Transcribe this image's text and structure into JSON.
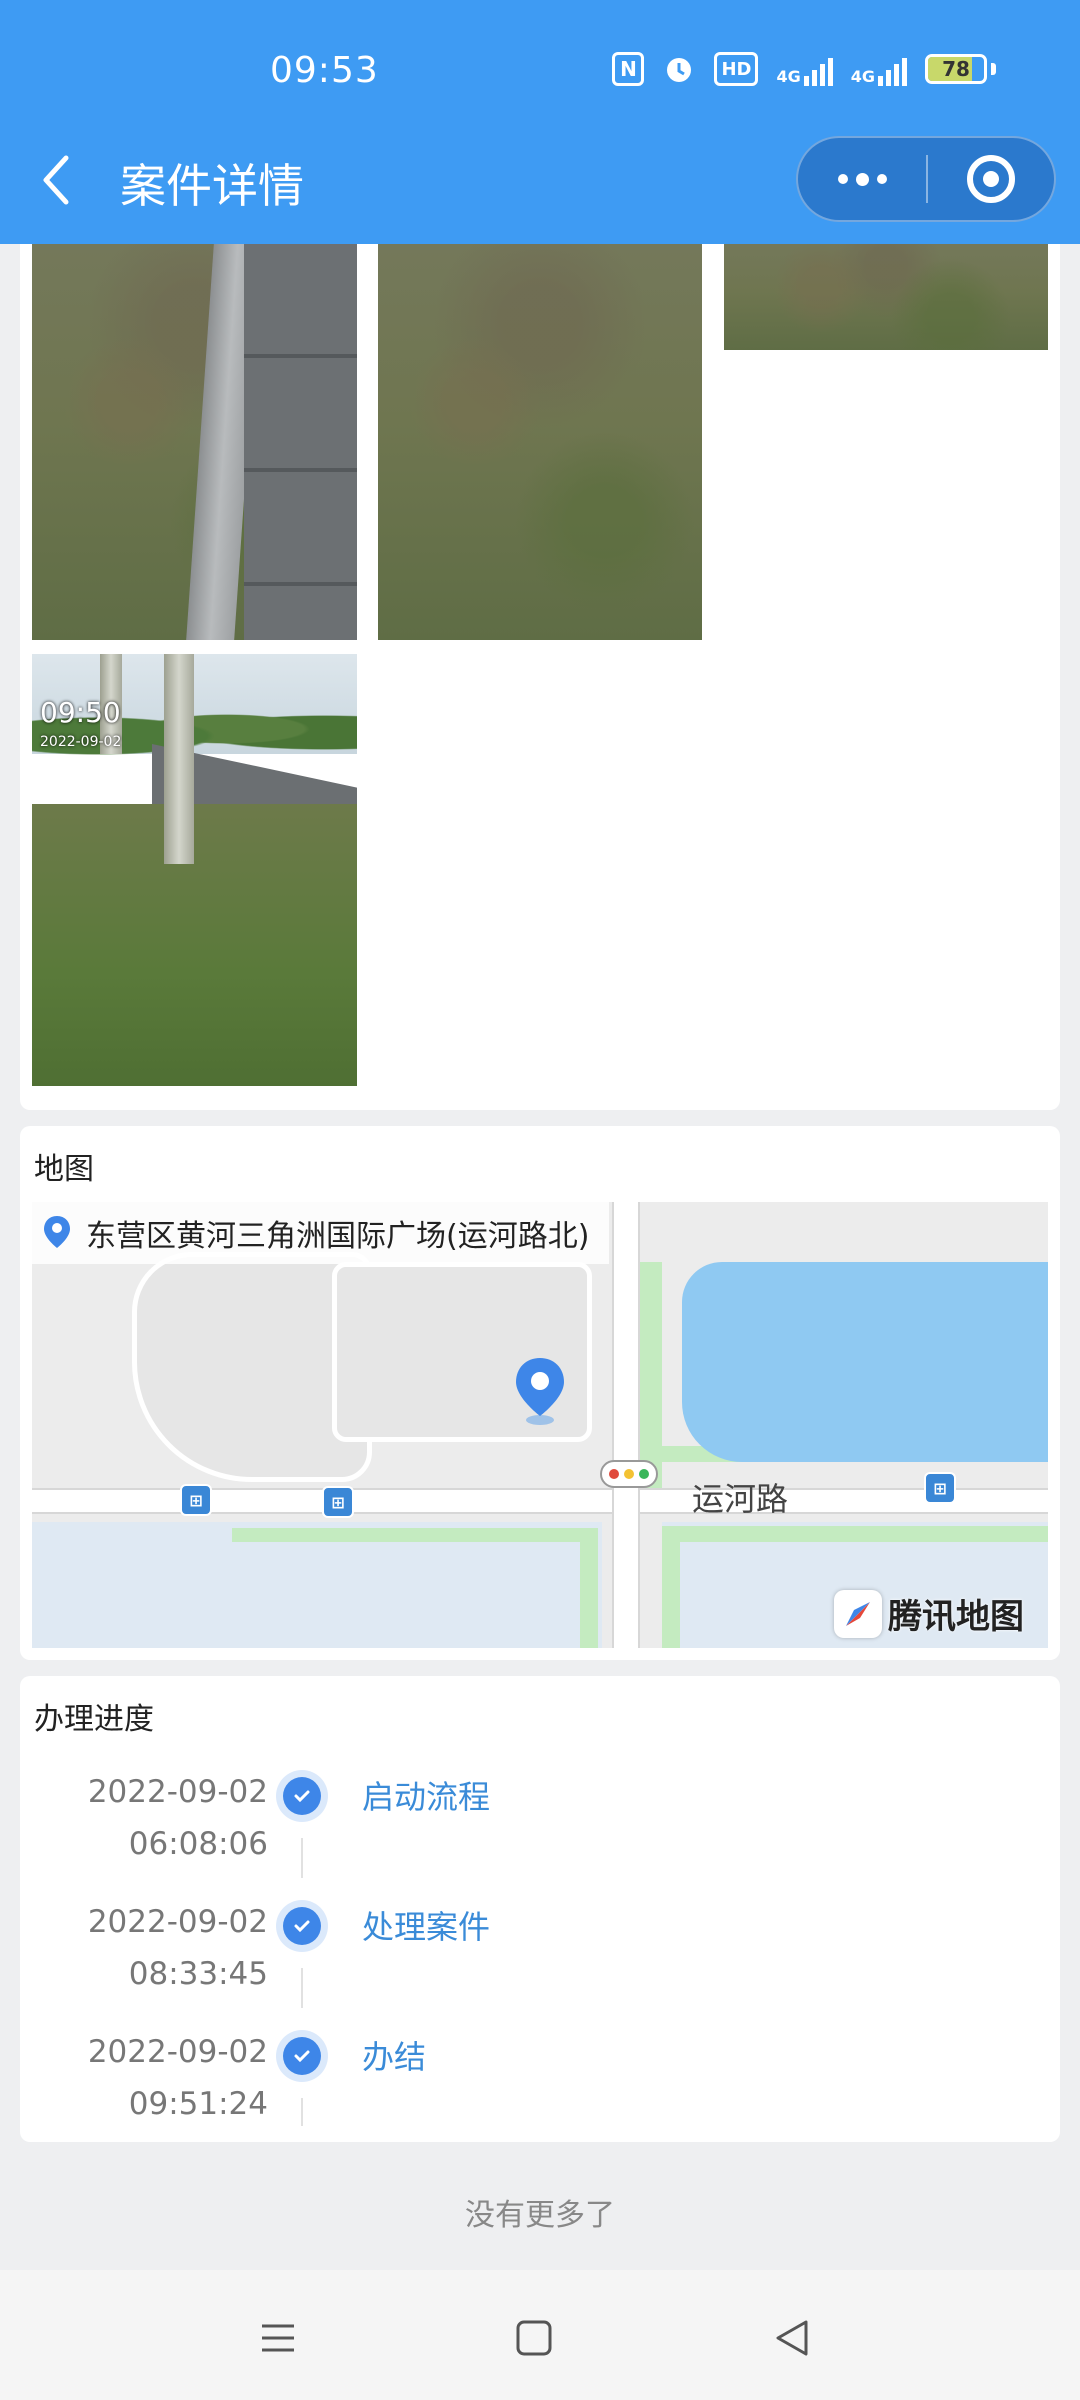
{
  "status_bar": {
    "time": "09:53",
    "network_1": "4G",
    "network_2": "4G",
    "battery_level": "78",
    "icons": [
      "nfc-icon",
      "alarm-icon",
      "hd-icon",
      "signal-icon",
      "signal-icon",
      "battery-icon"
    ]
  },
  "header": {
    "title": "案件详情",
    "back_icon": "chevron-left-icon",
    "more_icon": "more-dots-icon",
    "close_icon": "target-close-icon"
  },
  "photos": {
    "watermark_time": "09:50",
    "watermark_date": "2022-09-02"
  },
  "map_section": {
    "title": "地图",
    "address": "东营区黄河三角洲国际广场(运河路北)",
    "road_label": "运河路",
    "provider": "腾讯地图",
    "colors": {
      "water": "#8fc9f2",
      "green": "#c4ebc0",
      "pin": "#3e86e8"
    }
  },
  "progress_section": {
    "title": "办理进度",
    "steps": [
      {
        "date": "2022-09-02",
        "time": "06:08:06",
        "label": "启动流程"
      },
      {
        "date": "2022-09-02",
        "time": "08:33:45",
        "label": "处理案件"
      },
      {
        "date": "2022-09-02",
        "time": "09:51:24",
        "label": "办结"
      }
    ]
  },
  "footer": {
    "no_more": "没有更多了"
  },
  "colors": {
    "accent": "#3e9bf3",
    "link": "#3a8bd8",
    "background": "#eeeff1"
  }
}
